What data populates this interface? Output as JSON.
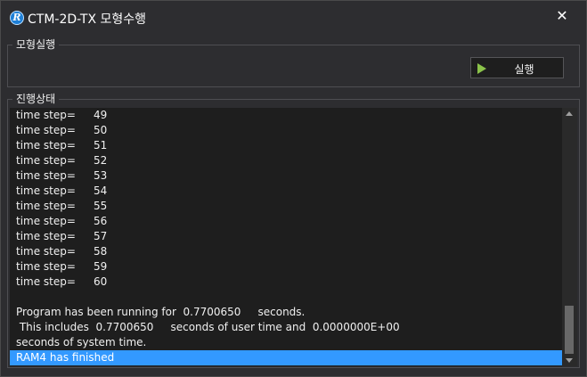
{
  "window": {
    "title": "CTM-2D-TX 모형수행",
    "app_icon_letter": "R",
    "close_symbol": "✕"
  },
  "run_group": {
    "label": "모형실행",
    "run_button_label": "실행"
  },
  "progress_group": {
    "label": "진행상태",
    "time_steps": [
      {
        "label": "time step=",
        "value": "49"
      },
      {
        "label": "time step=",
        "value": "50"
      },
      {
        "label": "time step=",
        "value": "51"
      },
      {
        "label": "time step=",
        "value": "52"
      },
      {
        "label": "time step=",
        "value": "53"
      },
      {
        "label": "time step=",
        "value": "54"
      },
      {
        "label": "time step=",
        "value": "55"
      },
      {
        "label": "time step=",
        "value": "56"
      },
      {
        "label": "time step=",
        "value": "57"
      },
      {
        "label": "time step=",
        "value": "58"
      },
      {
        "label": "time step=",
        "value": "59"
      },
      {
        "label": "time step=",
        "value": "60"
      }
    ],
    "summary_lines": [
      "Program has been running for  0.7700650     seconds.",
      " This includes  0.7700650     seconds of user time and  0.0000000E+00",
      "seconds of system time."
    ],
    "finished_line": "RAM4 has finished"
  },
  "colors": {
    "selection": "#3399ff",
    "play_icon": "#8bc34a"
  }
}
